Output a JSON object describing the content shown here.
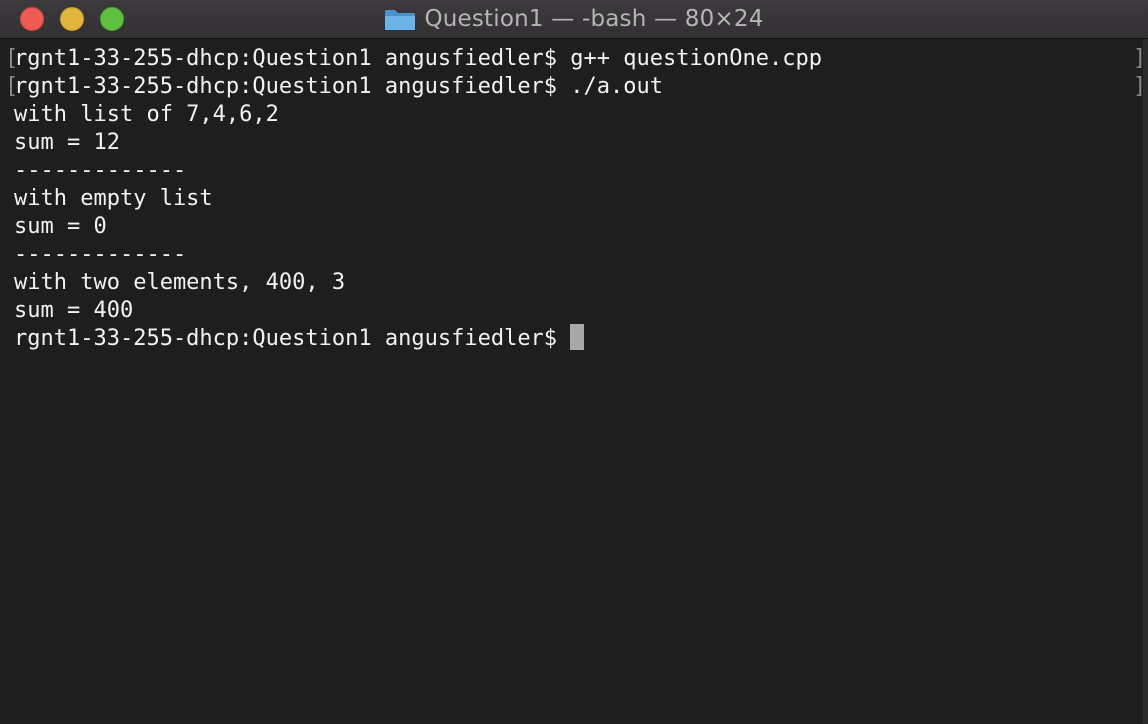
{
  "window": {
    "title": "Question1 — -bash — 80×24",
    "title_icon": "folder-icon"
  },
  "terminal": {
    "lines": [
      "rgnt1-33-255-dhcp:Question1 angusfiedler$ g++ questionOne.cpp",
      "rgnt1-33-255-dhcp:Question1 angusfiedler$ ./a.out",
      "with list of 7,4,6,2",
      "sum = 12",
      "-------------",
      "with empty list",
      "sum = 0",
      "-------------",
      "with two elements, 400, 3",
      "sum = 400"
    ],
    "prompt": "rgnt1-33-255-dhcp:Question1 angusfiedler$ ",
    "bracket_left": "[",
    "bracket_right": "]"
  },
  "colors": {
    "background": "#1e1e1e",
    "text": "#f2f2f2",
    "cursor": "#a8a8a8",
    "close": "#ee5b54",
    "minimize": "#e0b73c",
    "zoom": "#5fc03f",
    "folder": "#5aa7e0"
  }
}
